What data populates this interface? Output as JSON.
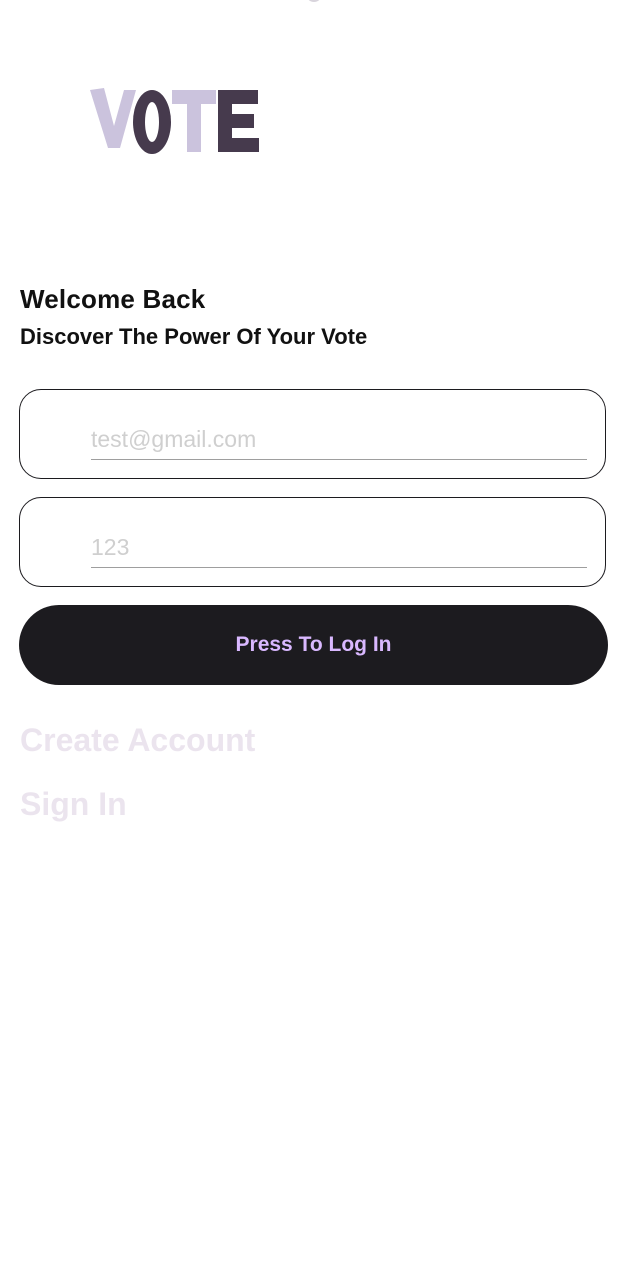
{
  "logo": {
    "text": "VOTE",
    "colors": {
      "light": "#cbc3dd",
      "dark": "#463a4d"
    }
  },
  "header": {
    "title": "Welcome Back",
    "subtitle": "Discover The Power Of Your Vote"
  },
  "form": {
    "email_placeholder": "test@gmail.com",
    "password_placeholder": "123",
    "login_label": "Press To Log In"
  },
  "links": {
    "create_account": "Create Account",
    "sign_in": "Sign In"
  },
  "colors": {
    "button_bg": "#1c1b1f",
    "button_text": "#d9b8ff",
    "link_text": "#ebe4ee",
    "field_border": "#1c1b1f"
  }
}
